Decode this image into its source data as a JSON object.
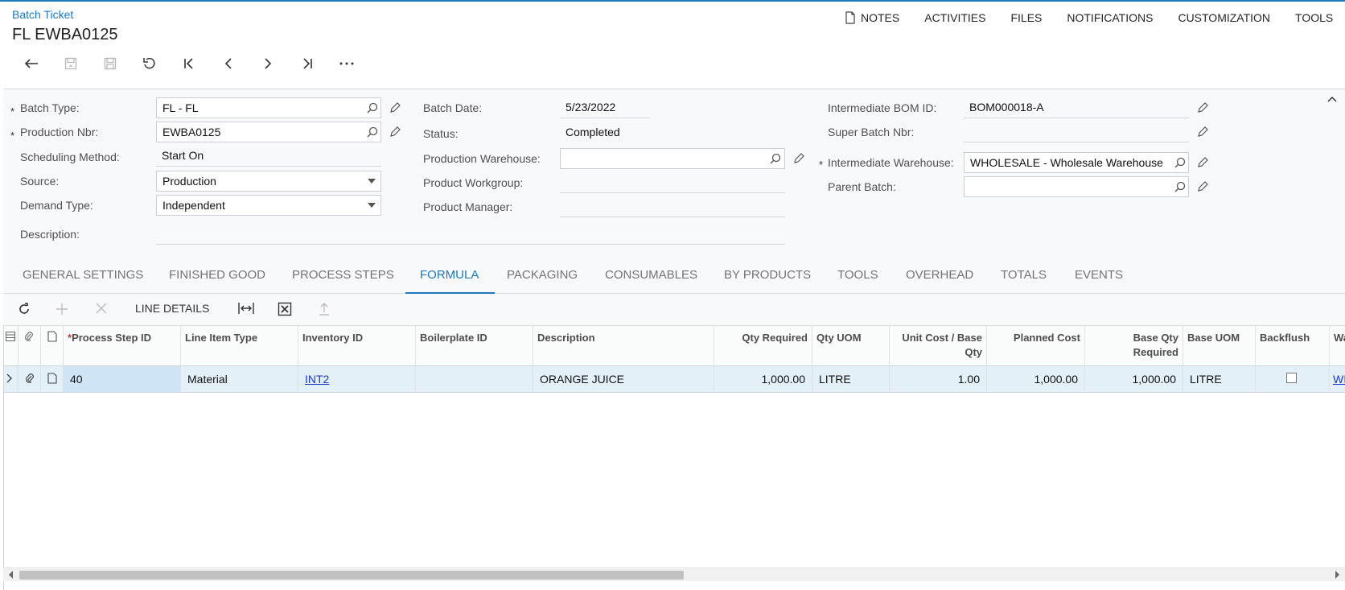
{
  "header": {
    "breadcrumb": "Batch Ticket",
    "title": "FL EWBA0125",
    "menu": [
      "NOTES",
      "ACTIVITIES",
      "FILES",
      "NOTIFICATIONS",
      "CUSTOMIZATION",
      "TOOLS"
    ]
  },
  "icons": {
    "back": "arrow-left-icon",
    "save_close": "save-close-icon",
    "save": "save-icon",
    "undo": "undo-icon",
    "first": "first-record-icon",
    "prev": "previous-record-icon",
    "next": "next-record-icon",
    "last": "last-record-icon",
    "more": "more-icon"
  },
  "form": {
    "batch_type": {
      "label": "Batch Type:",
      "value": "FL - FL"
    },
    "production_nbr": {
      "label": "Production Nbr:",
      "value": "EWBA0125"
    },
    "scheduling_method": {
      "label": "Scheduling Method:",
      "value": "Start On"
    },
    "source": {
      "label": "Source:",
      "value": "Production"
    },
    "demand_type": {
      "label": "Demand Type:",
      "value": "Independent"
    },
    "description": {
      "label": "Description:",
      "value": ""
    },
    "batch_date": {
      "label": "Batch Date:",
      "value": "5/23/2022"
    },
    "status": {
      "label": "Status:",
      "value": "Completed"
    },
    "production_warehouse": {
      "label": "Production Warehouse:",
      "value": ""
    },
    "product_workgroup": {
      "label": "Product Workgroup:",
      "value": ""
    },
    "product_manager": {
      "label": "Product Manager:",
      "value": ""
    },
    "intermediate_bom_id": {
      "label": "Intermediate BOM ID:",
      "value": "BOM000018-A"
    },
    "super_batch_nbr": {
      "label": "Super Batch Nbr:",
      "value": ""
    },
    "intermediate_warehouse": {
      "label": "Intermediate Warehouse:",
      "value": "WHOLESALE - Wholesale Warehouse"
    },
    "parent_batch": {
      "label": "Parent Batch:",
      "value": ""
    }
  },
  "tabs": [
    "GENERAL SETTINGS",
    "FINISHED GOOD",
    "PROCESS STEPS",
    "FORMULA",
    "PACKAGING",
    "CONSUMABLES",
    "BY PRODUCTS",
    "TOOLS",
    "OVERHEAD",
    "TOTALS",
    "EVENTS"
  ],
  "active_tab": "FORMULA",
  "grid_toolbar": {
    "line_details": "LINE DETAILS"
  },
  "grid": {
    "columns": [
      "Process Step ID",
      "Line Item Type",
      "Inventory ID",
      "Boilerplate ID",
      "Description",
      "Qty Required",
      "Qty UOM",
      "Unit Cost / Base Qty",
      "Planned Cost",
      "Base Qty Required",
      "Base UOM",
      "Backflush",
      "Wa"
    ],
    "rows": [
      {
        "process_step_id": "40",
        "line_item_type": "Material",
        "inventory_id": "INT2",
        "boilerplate_id": "",
        "description": "ORANGE JUICE",
        "qty_required": "1,000.00",
        "qty_uom": "LITRE",
        "unit_cost": "1.00",
        "planned_cost": "1,000.00",
        "base_qty_required": "1,000.00",
        "base_uom": "LITRE",
        "backflush": false,
        "warehouse": "WI"
      }
    ]
  },
  "colors": {
    "accent": "#1f77bd",
    "link": "#1a39d6",
    "row_selected": "#e3f0f8"
  }
}
